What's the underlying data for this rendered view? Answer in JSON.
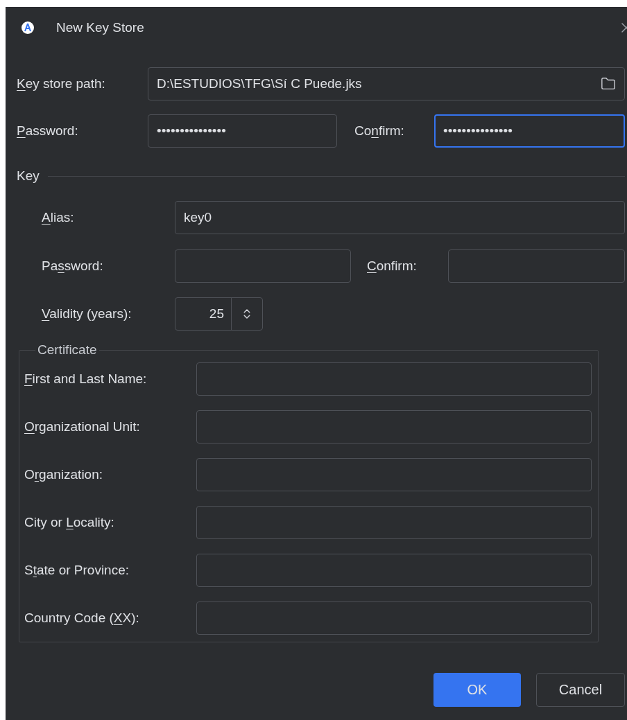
{
  "window": {
    "title": "New Key Store"
  },
  "key_store": {
    "path": {
      "label": {
        "key": "K",
        "post": "ey store path:"
      },
      "value": "D:\\ESTUDIOS\\TFG\\Sí C Puede.jks"
    },
    "password": {
      "label": {
        "key": "P",
        "post": "assword:"
      },
      "value": "•••••••••••••••",
      "focused": false
    },
    "confirm": {
      "label": {
        "pre": "Co",
        "key": "n",
        "post": "firm:"
      },
      "value": "•••••••••••••••",
      "focused": true
    }
  },
  "key": {
    "title": "Key",
    "alias": {
      "label": {
        "key": "A",
        "post": "lias:"
      },
      "value": "key0"
    },
    "password": {
      "label": {
        "pre": "Pa",
        "key": "s",
        "post": "sword:"
      },
      "focused": false
    },
    "confirm": {
      "label": {
        "key": "C",
        "post": "onfirm:"
      },
      "focused": false
    },
    "validity": {
      "label": {
        "key": "V",
        "post": "alidity (years):"
      },
      "value": "25"
    },
    "certificate": {
      "title": "Certificate",
      "fields": [
        {
          "label": {
            "key": "F",
            "post": "irst and Last Name:"
          }
        },
        {
          "label": {
            "key": "O",
            "post": "rganizational Unit:"
          }
        },
        {
          "label": {
            "pre": "O",
            "key": "r",
            "post": "ganization:"
          }
        },
        {
          "label": {
            "pre": "City or ",
            "key": "L",
            "post": "ocality:"
          }
        },
        {
          "label": {
            "pre": "S",
            "key": "t",
            "post": "ate or Province:"
          }
        },
        {
          "label": {
            "pre": "Country Code (",
            "key": "X",
            "post": "X):"
          }
        }
      ]
    }
  },
  "buttons": [
    {
      "label": "OK",
      "kind": "primary"
    },
    {
      "label": "Cancel",
      "kind": "secondary"
    }
  ]
}
